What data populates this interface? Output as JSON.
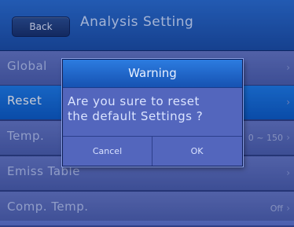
{
  "header": {
    "back_label": "Back",
    "title": "Analysis Setting"
  },
  "menu": {
    "items": [
      {
        "label": "Global",
        "value": "",
        "chevron": "›"
      },
      {
        "label": "Reset",
        "value": "",
        "chevron": "›"
      },
      {
        "label": "Temp.",
        "value": "0 ~ 150",
        "chevron": "›"
      },
      {
        "label": "Emiss Table",
        "value": "",
        "chevron": "›"
      },
      {
        "label": "Comp. Temp.",
        "value": "Off",
        "chevron": "›"
      }
    ]
  },
  "dialog": {
    "title": "Warning",
    "message_line1": "Are you sure to reset",
    "message_line2": "the default Settings ?",
    "cancel_label": "Cancel",
    "ok_label": "OK"
  },
  "colors": {
    "header_blue": "#1a4ea6",
    "selected_row": "#0b5cc7",
    "row_bg": "#5a6cbc",
    "dialog_bg": "#5366bd"
  }
}
